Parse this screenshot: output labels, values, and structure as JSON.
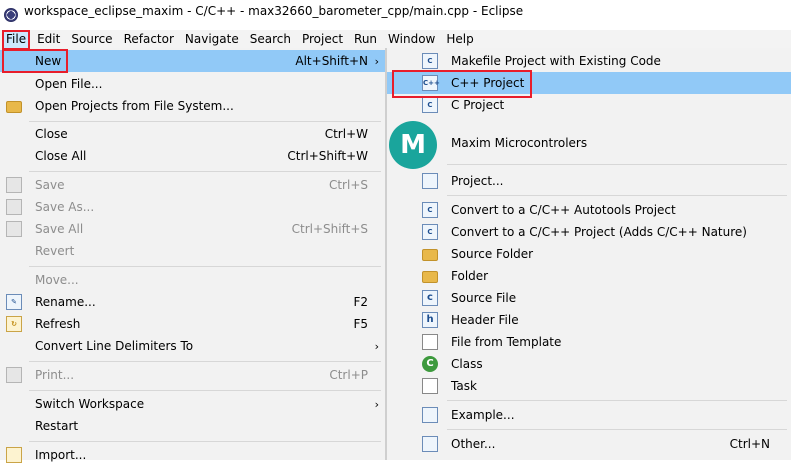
{
  "window": {
    "title": "workspace_eclipse_maxim - C/C++ - max32660_barometer_cpp/main.cpp - Eclipse"
  },
  "menubar": {
    "items": [
      {
        "label": "File",
        "active": true
      },
      {
        "label": "Edit"
      },
      {
        "label": "Source"
      },
      {
        "label": "Refactor"
      },
      {
        "label": "Navigate"
      },
      {
        "label": "Search"
      },
      {
        "label": "Project"
      },
      {
        "label": "Run"
      },
      {
        "label": "Window"
      },
      {
        "label": "Help"
      }
    ]
  },
  "file_menu": {
    "items": [
      {
        "label": "New",
        "shortcut": "Alt+Shift+N",
        "submenu": true,
        "highlighted": true
      },
      {
        "label": "Open File..."
      },
      {
        "label": "Open Projects from File System...",
        "icon": "folder-icon"
      },
      {
        "label": "Close",
        "shortcut": "Ctrl+W"
      },
      {
        "label": "Close All",
        "shortcut": "Ctrl+Shift+W"
      },
      {
        "label": "Save",
        "shortcut": "Ctrl+S",
        "disabled": true,
        "icon": "save-icon"
      },
      {
        "label": "Save As...",
        "disabled": true,
        "icon": "save-as-icon"
      },
      {
        "label": "Save All",
        "shortcut": "Ctrl+Shift+S",
        "disabled": true,
        "icon": "save-all-icon"
      },
      {
        "label": "Revert",
        "disabled": true
      },
      {
        "label": "Move...",
        "disabled": true
      },
      {
        "label": "Rename...",
        "shortcut": "F2",
        "icon": "rename-icon"
      },
      {
        "label": "Refresh",
        "shortcut": "F5",
        "icon": "refresh-icon"
      },
      {
        "label": "Convert Line Delimiters To",
        "submenu": true
      },
      {
        "label": "Print...",
        "shortcut": "Ctrl+P",
        "disabled": true,
        "icon": "print-icon"
      },
      {
        "label": "Switch Workspace",
        "submenu": true
      },
      {
        "label": "Restart"
      },
      {
        "label": "Import...",
        "icon": "import-icon"
      }
    ]
  },
  "new_submenu": {
    "items": [
      {
        "label": "Makefile Project with Existing Code",
        "icon": "cproject-icon"
      },
      {
        "label": "C++ Project",
        "icon": "cppproject-icon",
        "highlighted": true
      },
      {
        "label": "C Project",
        "icon": "cproject-icon"
      },
      {
        "label": "Maxim Microcontrolers",
        "icon": "maxim-logo"
      },
      {
        "label": "Project...",
        "icon": "project-icon"
      },
      {
        "label": "Convert to a C/C++ Autotools Project",
        "icon": "convert-icon"
      },
      {
        "label": "Convert to a C/C++ Project (Adds C/C++ Nature)",
        "icon": "convert-icon"
      },
      {
        "label": "Source Folder",
        "icon": "source-folder-icon"
      },
      {
        "label": "Folder",
        "icon": "folder-icon"
      },
      {
        "label": "Source File",
        "icon": "source-file-icon"
      },
      {
        "label": "Header File",
        "icon": "header-file-icon"
      },
      {
        "label": "File from Template",
        "icon": "template-file-icon"
      },
      {
        "label": "Class",
        "icon": "class-icon"
      },
      {
        "label": "Task",
        "icon": "task-icon"
      },
      {
        "label": "Example...",
        "icon": "example-icon"
      },
      {
        "label": "Other...",
        "shortcut": "Ctrl+N",
        "icon": "other-icon"
      }
    ]
  },
  "logo": {
    "text": "M"
  },
  "colors": {
    "highlight": "#91c9f7",
    "menubar_active": "#cce8ff",
    "annotation": "#e81d2b",
    "maxim_teal": "#1aa59c"
  }
}
